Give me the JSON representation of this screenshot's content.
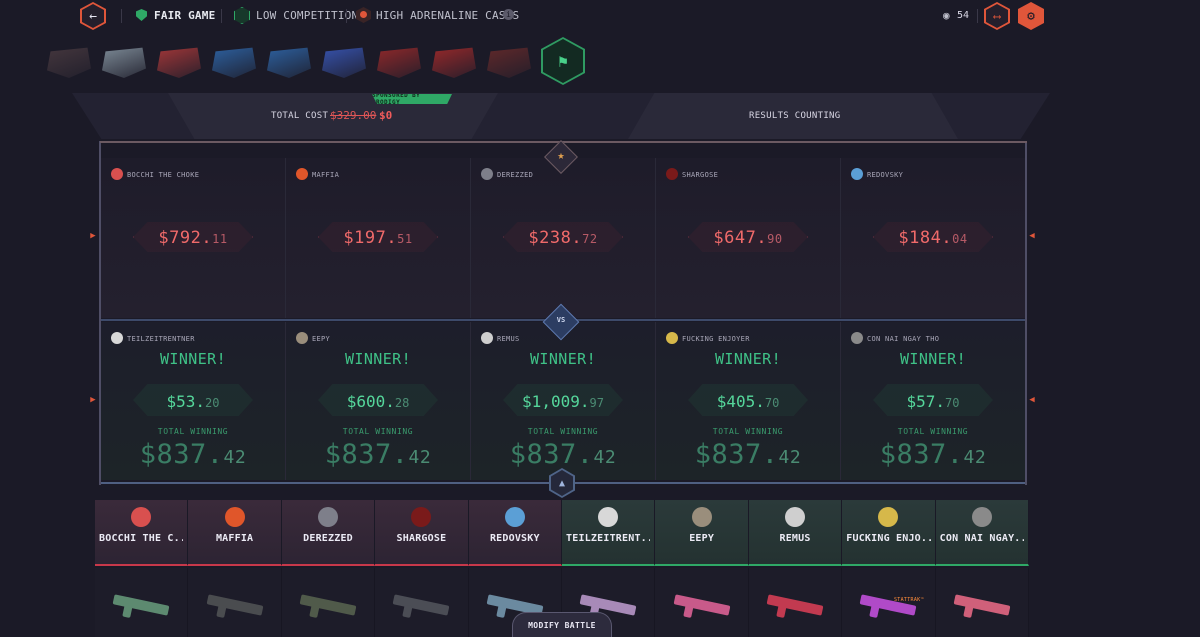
{
  "topbar": {
    "back_icon": "arrow-left-icon",
    "fair_game": "FAIR GAME",
    "low_competition": "LOW COMPETITION",
    "high_adrenaline": "HIGH ADRENALINE CASES",
    "viewers": "54",
    "share_icon": "share-icon",
    "settings_icon": "gear-icon"
  },
  "header": {
    "sponsor": "SPONSORED BY PRODIGY",
    "total_cost_label": "TOTAL COST",
    "total_cost_old": "$329.00",
    "total_cost_new": "$0",
    "results": "RESULTS COUNTING"
  },
  "losers": [
    {
      "name": "BOCCHI THE CHOKE",
      "dollars": "$792.",
      "cents": "11",
      "color": "#d9504f"
    },
    {
      "name": "MAFFIA",
      "dollars": "$197.",
      "cents": "51",
      "color": "#e0562a"
    },
    {
      "name": "DEREZZED",
      "dollars": "$238.",
      "cents": "72",
      "color": "#7e7f8a"
    },
    {
      "name": "SHARGOSE",
      "dollars": "$647.",
      "cents": "90",
      "color": "#7a1a1a"
    },
    {
      "name": "REDOVSKY",
      "dollars": "$184.",
      "cents": "04",
      "color": "#5b9fd6"
    }
  ],
  "winners": [
    {
      "name": "TEILZEITRENTNER",
      "winner": "WINNER!",
      "dollars": "$53.",
      "cents": "20",
      "total_label": "TOTAL WINNING",
      "total_dollars": "$837.",
      "total_cents": "42",
      "color": "#d8d8d8"
    },
    {
      "name": "EEPY",
      "winner": "WINNER!",
      "dollars": "$600.",
      "cents": "28",
      "total_label": "TOTAL WINNING",
      "total_dollars": "$837.",
      "total_cents": "42",
      "color": "#9a8e7c"
    },
    {
      "name": "REMUS",
      "winner": "WINNER!",
      "dollars": "$1,009.",
      "cents": "97",
      "total_label": "TOTAL WINNING",
      "total_dollars": "$837.",
      "total_cents": "42",
      "color": "#cfcfcf"
    },
    {
      "name": "FUCKING ENJOYER",
      "winner": "WINNER!",
      "dollars": "$405.",
      "cents": "70",
      "total_label": "TOTAL WINNING",
      "total_dollars": "$837.",
      "total_cents": "42",
      "color": "#d6b84a"
    },
    {
      "name": "CON NAI NGAY THO",
      "winner": "WINNER!",
      "dollars": "$57.",
      "cents": "70",
      "total_label": "TOTAL WINNING",
      "total_dollars": "$837.",
      "total_cents": "42",
      "color": "#8a8a8a"
    }
  ],
  "player_tabs": [
    {
      "label": "BOCCHI THE C...",
      "team": "red",
      "color": "#d9504f"
    },
    {
      "label": "MAFFIA",
      "team": "red",
      "color": "#e0562a"
    },
    {
      "label": "DEREZZED",
      "team": "red",
      "color": "#7e7f8a"
    },
    {
      "label": "SHARGOSE",
      "team": "red",
      "color": "#7a1a1a"
    },
    {
      "label": "REDOVSKY",
      "team": "red",
      "color": "#5b9fd6"
    },
    {
      "label": "TEILZEITRENT...",
      "team": "green",
      "color": "#d8d8d8"
    },
    {
      "label": "EEPY",
      "team": "green",
      "color": "#9a8e7c"
    },
    {
      "label": "REMUS",
      "team": "green",
      "color": "#cfcfcf"
    },
    {
      "label": "FUCKING ENJO...",
      "team": "green",
      "color": "#d6b84a"
    },
    {
      "label": "CON NAI NGAY...",
      "team": "green",
      "color": "#8a8a8a"
    }
  ],
  "weapons": [
    {
      "color": "#5d8a70"
    },
    {
      "color": "#4a4c4f"
    },
    {
      "color": "#505a4a"
    },
    {
      "color": "#4b4d55"
    },
    {
      "color": "#6b8aa0"
    },
    {
      "color": "#a88ab8"
    },
    {
      "color": "#c85a8a"
    },
    {
      "color": "#c23a50"
    },
    {
      "color": "#b04ac8"
    },
    {
      "color": "#d0607a"
    }
  ],
  "stattrak": "STATTRAK™",
  "modify": "MODIFY BATTLE",
  "cases": [
    {
      "color": "#4a3a40"
    },
    {
      "color": "#8a9aa6"
    },
    {
      "color": "#b43a3a"
    },
    {
      "color": "#2f6ab0"
    },
    {
      "color": "#2f6ab0"
    },
    {
      "color": "#3a5ac0"
    },
    {
      "color": "#a02a2a"
    },
    {
      "color": "#a82a2a"
    },
    {
      "color": "#6a2a2a"
    }
  ]
}
